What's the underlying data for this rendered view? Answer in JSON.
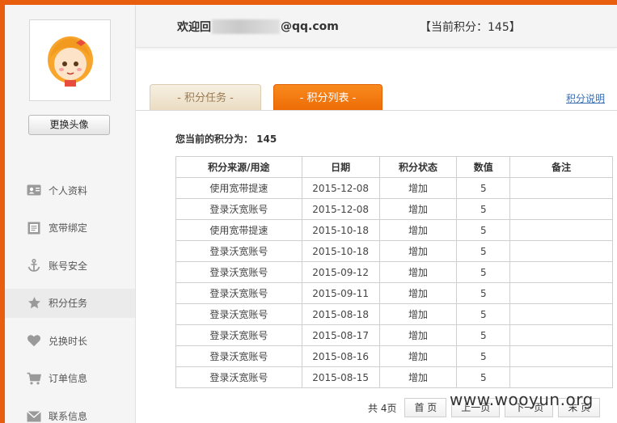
{
  "header": {
    "welcome_prefix": "欢迎回",
    "email_suffix": "@qq.com",
    "points_label": "【当前积分：145】"
  },
  "sidebar": {
    "change_avatar": "更换头像",
    "items": [
      {
        "label": "个人资料",
        "icon": "id-card-icon"
      },
      {
        "label": "宽带绑定",
        "icon": "document-icon"
      },
      {
        "label": "账号安全",
        "icon": "anchor-icon"
      },
      {
        "label": "积分任务",
        "icon": "star-icon"
      },
      {
        "label": "兑换时长",
        "icon": "heart-icon"
      },
      {
        "label": "订单信息",
        "icon": "cart-icon"
      },
      {
        "label": "联系信息",
        "icon": "mail-icon"
      }
    ],
    "active_index": 3
  },
  "tabs": [
    {
      "label": "- 积分任务 -"
    },
    {
      "label": "- 积分列表 -"
    }
  ],
  "points_explain": "积分说明",
  "current_points": "您当前的积分为： 145",
  "table": {
    "headers": [
      "积分来源/用途",
      "日期",
      "积分状态",
      "数值",
      "备注"
    ],
    "rows": [
      [
        "使用宽带提速",
        "2015-12-08",
        "增加",
        "5",
        ""
      ],
      [
        "登录沃宽账号",
        "2015-12-08",
        "增加",
        "5",
        ""
      ],
      [
        "使用宽带提速",
        "2015-10-18",
        "增加",
        "5",
        ""
      ],
      [
        "登录沃宽账号",
        "2015-10-18",
        "增加",
        "5",
        ""
      ],
      [
        "登录沃宽账号",
        "2015-09-12",
        "增加",
        "5",
        ""
      ],
      [
        "登录沃宽账号",
        "2015-09-11",
        "增加",
        "5",
        ""
      ],
      [
        "登录沃宽账号",
        "2015-08-18",
        "增加",
        "5",
        ""
      ],
      [
        "登录沃宽账号",
        "2015-08-17",
        "增加",
        "5",
        ""
      ],
      [
        "登录沃宽账号",
        "2015-08-16",
        "增加",
        "5",
        ""
      ],
      [
        "登录沃宽账号",
        "2015-08-15",
        "增加",
        "5",
        ""
      ]
    ]
  },
  "pagination": {
    "total": "共 4页",
    "first": "首 页",
    "prev": "上一页",
    "next": "下一页",
    "last": "末 页"
  },
  "watermark": "www.wooyun.org",
  "colors": {
    "accent": "#e85d0e",
    "tab_active": "#f47a12",
    "link": "#3b6fb0"
  }
}
